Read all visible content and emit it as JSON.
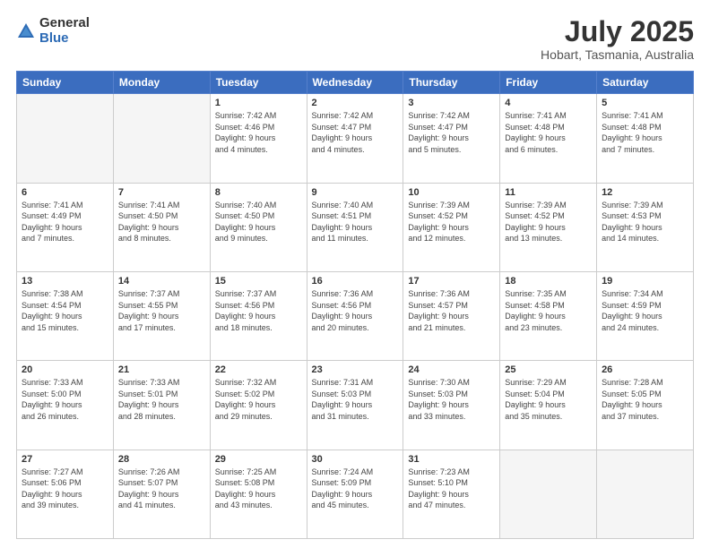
{
  "logo": {
    "general": "General",
    "blue": "Blue"
  },
  "title": {
    "month_year": "July 2025",
    "location": "Hobart, Tasmania, Australia"
  },
  "calendar": {
    "headers": [
      "Sunday",
      "Monday",
      "Tuesday",
      "Wednesday",
      "Thursday",
      "Friday",
      "Saturday"
    ],
    "weeks": [
      [
        {
          "day": "",
          "info": ""
        },
        {
          "day": "",
          "info": ""
        },
        {
          "day": "1",
          "info": "Sunrise: 7:42 AM\nSunset: 4:46 PM\nDaylight: 9 hours\nand 4 minutes."
        },
        {
          "day": "2",
          "info": "Sunrise: 7:42 AM\nSunset: 4:47 PM\nDaylight: 9 hours\nand 4 minutes."
        },
        {
          "day": "3",
          "info": "Sunrise: 7:42 AM\nSunset: 4:47 PM\nDaylight: 9 hours\nand 5 minutes."
        },
        {
          "day": "4",
          "info": "Sunrise: 7:41 AM\nSunset: 4:48 PM\nDaylight: 9 hours\nand 6 minutes."
        },
        {
          "day": "5",
          "info": "Sunrise: 7:41 AM\nSunset: 4:48 PM\nDaylight: 9 hours\nand 7 minutes."
        }
      ],
      [
        {
          "day": "6",
          "info": "Sunrise: 7:41 AM\nSunset: 4:49 PM\nDaylight: 9 hours\nand 7 minutes."
        },
        {
          "day": "7",
          "info": "Sunrise: 7:41 AM\nSunset: 4:50 PM\nDaylight: 9 hours\nand 8 minutes."
        },
        {
          "day": "8",
          "info": "Sunrise: 7:40 AM\nSunset: 4:50 PM\nDaylight: 9 hours\nand 9 minutes."
        },
        {
          "day": "9",
          "info": "Sunrise: 7:40 AM\nSunset: 4:51 PM\nDaylight: 9 hours\nand 11 minutes."
        },
        {
          "day": "10",
          "info": "Sunrise: 7:39 AM\nSunset: 4:52 PM\nDaylight: 9 hours\nand 12 minutes."
        },
        {
          "day": "11",
          "info": "Sunrise: 7:39 AM\nSunset: 4:52 PM\nDaylight: 9 hours\nand 13 minutes."
        },
        {
          "day": "12",
          "info": "Sunrise: 7:39 AM\nSunset: 4:53 PM\nDaylight: 9 hours\nand 14 minutes."
        }
      ],
      [
        {
          "day": "13",
          "info": "Sunrise: 7:38 AM\nSunset: 4:54 PM\nDaylight: 9 hours\nand 15 minutes."
        },
        {
          "day": "14",
          "info": "Sunrise: 7:37 AM\nSunset: 4:55 PM\nDaylight: 9 hours\nand 17 minutes."
        },
        {
          "day": "15",
          "info": "Sunrise: 7:37 AM\nSunset: 4:56 PM\nDaylight: 9 hours\nand 18 minutes."
        },
        {
          "day": "16",
          "info": "Sunrise: 7:36 AM\nSunset: 4:56 PM\nDaylight: 9 hours\nand 20 minutes."
        },
        {
          "day": "17",
          "info": "Sunrise: 7:36 AM\nSunset: 4:57 PM\nDaylight: 9 hours\nand 21 minutes."
        },
        {
          "day": "18",
          "info": "Sunrise: 7:35 AM\nSunset: 4:58 PM\nDaylight: 9 hours\nand 23 minutes."
        },
        {
          "day": "19",
          "info": "Sunrise: 7:34 AM\nSunset: 4:59 PM\nDaylight: 9 hours\nand 24 minutes."
        }
      ],
      [
        {
          "day": "20",
          "info": "Sunrise: 7:33 AM\nSunset: 5:00 PM\nDaylight: 9 hours\nand 26 minutes."
        },
        {
          "day": "21",
          "info": "Sunrise: 7:33 AM\nSunset: 5:01 PM\nDaylight: 9 hours\nand 28 minutes."
        },
        {
          "day": "22",
          "info": "Sunrise: 7:32 AM\nSunset: 5:02 PM\nDaylight: 9 hours\nand 29 minutes."
        },
        {
          "day": "23",
          "info": "Sunrise: 7:31 AM\nSunset: 5:03 PM\nDaylight: 9 hours\nand 31 minutes."
        },
        {
          "day": "24",
          "info": "Sunrise: 7:30 AM\nSunset: 5:03 PM\nDaylight: 9 hours\nand 33 minutes."
        },
        {
          "day": "25",
          "info": "Sunrise: 7:29 AM\nSunset: 5:04 PM\nDaylight: 9 hours\nand 35 minutes."
        },
        {
          "day": "26",
          "info": "Sunrise: 7:28 AM\nSunset: 5:05 PM\nDaylight: 9 hours\nand 37 minutes."
        }
      ],
      [
        {
          "day": "27",
          "info": "Sunrise: 7:27 AM\nSunset: 5:06 PM\nDaylight: 9 hours\nand 39 minutes."
        },
        {
          "day": "28",
          "info": "Sunrise: 7:26 AM\nSunset: 5:07 PM\nDaylight: 9 hours\nand 41 minutes."
        },
        {
          "day": "29",
          "info": "Sunrise: 7:25 AM\nSunset: 5:08 PM\nDaylight: 9 hours\nand 43 minutes."
        },
        {
          "day": "30",
          "info": "Sunrise: 7:24 AM\nSunset: 5:09 PM\nDaylight: 9 hours\nand 45 minutes."
        },
        {
          "day": "31",
          "info": "Sunrise: 7:23 AM\nSunset: 5:10 PM\nDaylight: 9 hours\nand 47 minutes."
        },
        {
          "day": "",
          "info": ""
        },
        {
          "day": "",
          "info": ""
        }
      ]
    ]
  }
}
